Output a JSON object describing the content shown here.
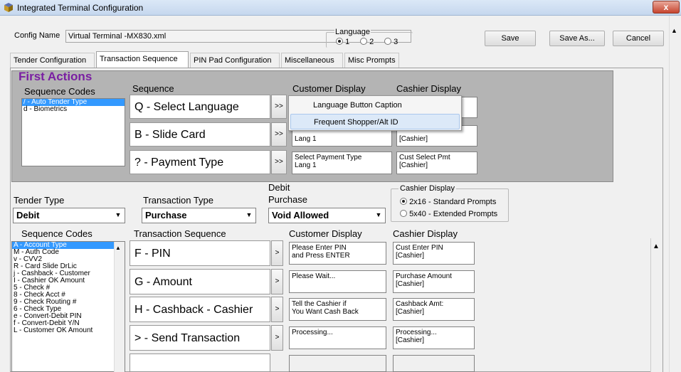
{
  "window": {
    "title": "Integrated Terminal Configuration",
    "close_label": "x"
  },
  "config": {
    "name_label": "Config Name",
    "name_value": "Virtual Terminal -MX830.xml",
    "language_label": "Language",
    "language_options": [
      "1",
      "2",
      "3"
    ],
    "language_selected": "1",
    "save_label": "Save",
    "save_as_label": "Save As...",
    "cancel_label": "Cancel"
  },
  "tabs": [
    {
      "label": "Tender Configuration"
    },
    {
      "label": "Transaction Sequence",
      "active": true
    },
    {
      "label": "PIN Pad Configuration"
    },
    {
      "label": "Miscellaneous"
    },
    {
      "label": "Misc Prompts"
    }
  ],
  "first_actions": {
    "title": "First Actions",
    "codes_header": "Sequence Codes",
    "sequence_header": "Sequence",
    "customer_header": "Customer Display",
    "cashier_header": "Cashier Display",
    "codes": [
      {
        "label": "/ - Auto Tender Type",
        "selected": true
      },
      {
        "label": "d - Biometrics"
      }
    ],
    "rows": [
      {
        "seq": "Q - Select Language",
        "arrow": ">>",
        "customer": "",
        "cashier": ""
      },
      {
        "seq": "B - Slide Card",
        "arrow": ">>",
        "customer": "Lang 1",
        "cashier": "[Cashier]"
      },
      {
        "seq": "? - Payment Type",
        "arrow": ">>",
        "customer": "Select Payment Type\nLang 1",
        "cashier": "Cust Select Pmt\n[Cashier]"
      }
    ]
  },
  "context_menu": {
    "items": [
      {
        "label": "Language Button Caption"
      },
      {
        "label": "Frequent Shopper/Alt ID",
        "highlighted": true
      }
    ]
  },
  "tender": {
    "tender_type_label": "Tender Type",
    "tender_type_value": "Debit",
    "transaction_type_label": "Transaction Type",
    "transaction_type_value": "Purchase",
    "debit_purchase_label_1": "Debit",
    "debit_purchase_label_2": "Purchase",
    "debit_purchase_value": "Void Allowed",
    "cashier_display_label": "Cashier Display",
    "cashier_display_options": [
      "2x16 - Standard Prompts",
      "5x40 - Extended Prompts"
    ],
    "cashier_display_selected": "2x16 - Standard Prompts"
  },
  "transaction": {
    "codes_header": "Sequence Codes",
    "sequence_header": "Transaction Sequence",
    "customer_header": "Customer Display",
    "cashier_header": "Cashier Display",
    "codes": [
      {
        "label": "A - Account Type",
        "selected": true
      },
      {
        "label": "M - Auth Code"
      },
      {
        "label": "v - CVV2"
      },
      {
        "label": "R - Card Slide DrLic"
      },
      {
        "label": "j - Cashback - Customer"
      },
      {
        "label": "I - Cashier OK Amount"
      },
      {
        "label": "5 - Check #"
      },
      {
        "label": "8 - Check Acct #"
      },
      {
        "label": "9 - Check Routing #"
      },
      {
        "label": "6 - Check Type"
      },
      {
        "label": "e - Convert-Debit PIN"
      },
      {
        "label": "f - Convert-Debit Y/N"
      },
      {
        "label": "L - Customer OK Amount"
      }
    ],
    "rows": [
      {
        "seq": "F - PIN",
        "arrow": ">",
        "customer": "Please Enter PIN\nand Press ENTER",
        "cashier": "Cust Enter PIN\n[Cashier]"
      },
      {
        "seq": "G - Amount",
        "arrow": ">",
        "customer": "Please Wait...",
        "cashier": "Purchase Amount\n[Cashier]"
      },
      {
        "seq": "H - Cashback - Cashier",
        "arrow": ">",
        "customer": "Tell the Cashier if\nYou Want Cash Back",
        "cashier": "Cashback Amt:\n[Cashier]"
      },
      {
        "seq": "> - Send Transaction",
        "arrow": ">",
        "customer": "Processing...",
        "cashier": "Processing...\n[Cashier]"
      },
      {
        "seq": "",
        "arrow": "",
        "customer": "",
        "cashier": ""
      }
    ]
  },
  "icons": {
    "title": "terminal-icon",
    "close": "close-icon",
    "dropdown": "chevron-down-icon"
  },
  "colors": {
    "first_actions_title": "#7a1fa2",
    "selection": "#3399ff",
    "close": "#c7452f"
  }
}
